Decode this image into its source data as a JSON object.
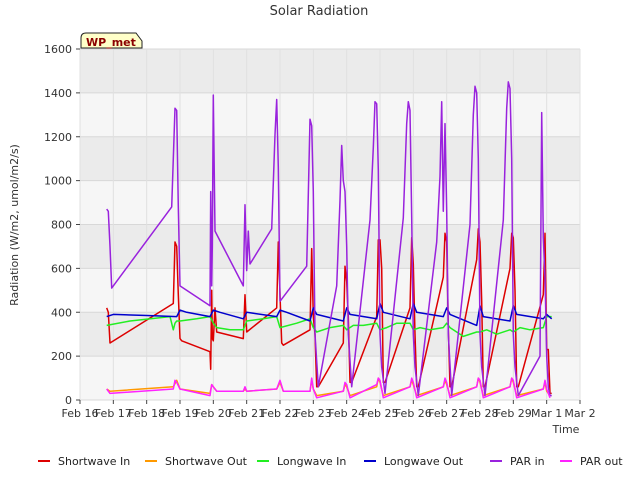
{
  "chart_data": {
    "type": "line",
    "title": "Solar Radiation",
    "xlabel": "Time",
    "ylabel": "Radiation (W/m2, umol/m2/s)",
    "badge": "WP_met",
    "x_range_days": [
      16,
      31
    ],
    "ylim": [
      0,
      1600
    ],
    "yticks": [
      0,
      200,
      400,
      600,
      800,
      1000,
      1200,
      1400,
      1600
    ],
    "xticks": [
      {
        "x": 16,
        "label": "Feb 16"
      },
      {
        "x": 17,
        "label": "Feb 17"
      },
      {
        "x": 18,
        "label": "Feb 18"
      },
      {
        "x": 19,
        "label": "Feb 19"
      },
      {
        "x": 20,
        "label": "Feb 20"
      },
      {
        "x": 21,
        "label": "Feb 21"
      },
      {
        "x": 22,
        "label": "Feb 22"
      },
      {
        "x": 23,
        "label": "Feb 23"
      },
      {
        "x": 24,
        "label": "Feb 24"
      },
      {
        "x": 25,
        "label": "Feb 25"
      },
      {
        "x": 26,
        "label": "Feb 26"
      },
      {
        "x": 27,
        "label": "Feb 27"
      },
      {
        "x": 28,
        "label": "Feb 28"
      },
      {
        "x": 29,
        "label": "Feb 29"
      },
      {
        "x": 30,
        "label": "Mar 1"
      },
      {
        "x": 31,
        "label": "Mar 2"
      }
    ],
    "grid": true,
    "legend_position": "bottom",
    "series": [
      {
        "name": "Shortwave In",
        "color": "#dd0000",
        "x": [
          16.8,
          16.85,
          16.9,
          18.8,
          18.85,
          18.9,
          18.95,
          19.0,
          19.05,
          19.9,
          19.92,
          19.95,
          19.97,
          20.0,
          20.05,
          20.1,
          20.9,
          20.95,
          21.0,
          21.9,
          21.95,
          22.0,
          22.05,
          22.1,
          22.9,
          22.95,
          23.0,
          23.05,
          23.1,
          23.15,
          23.9,
          23.95,
          24.0,
          24.05,
          24.1,
          24.15,
          24.9,
          24.95,
          25.0,
          25.05,
          25.1,
          25.15,
          25.9,
          25.95,
          26.0,
          26.05,
          26.1,
          26.15,
          26.9,
          26.95,
          27.0,
          27.05,
          27.1,
          27.15,
          27.9,
          27.95,
          28.0,
          28.05,
          28.1,
          28.15,
          28.9,
          28.95,
          29.0,
          29.05,
          29.1,
          29.15,
          29.9,
          29.95,
          30.0,
          30.05,
          30.1,
          30.15
        ],
        "y": [
          420,
          400,
          260,
          440,
          720,
          700,
          480,
          280,
          270,
          220,
          140,
          500,
          280,
          270,
          420,
          310,
          280,
          480,
          310,
          420,
          720,
          480,
          260,
          250,
          320,
          690,
          380,
          300,
          60,
          60,
          260,
          610,
          540,
          380,
          80,
          80,
          380,
          730,
          730,
          600,
          80,
          80,
          420,
          740,
          620,
          300,
          60,
          60,
          560,
          760,
          720,
          330,
          60,
          60,
          640,
          780,
          720,
          450,
          60,
          60,
          600,
          760,
          740,
          500,
          60,
          60,
          480,
          760,
          230,
          230,
          30,
          30
        ]
      },
      {
        "name": "Shortwave Out",
        "color": "#ff9900",
        "x": [
          16.8,
          16.9,
          18.8,
          18.9,
          19.0,
          19.9,
          19.95,
          20.0,
          20.05,
          20.1,
          20.9,
          20.95,
          21.0,
          21.9,
          22.0,
          22.1,
          22.9,
          22.95,
          23.0,
          23.1,
          23.9,
          23.95,
          24.0,
          24.1,
          24.9,
          24.95,
          25.0,
          25.1,
          25.9,
          25.95,
          26.0,
          26.1,
          26.9,
          26.95,
          27.0,
          27.1,
          27.9,
          27.95,
          28.0,
          28.1,
          28.9,
          28.95,
          29.0,
          29.1,
          29.9,
          29.95,
          30.0,
          30.1
        ],
        "y": [
          50,
          40,
          60,
          90,
          50,
          30,
          70,
          60,
          50,
          40,
          40,
          50,
          40,
          50,
          80,
          40,
          40,
          90,
          50,
          20,
          40,
          70,
          60,
          20,
          60,
          100,
          80,
          20,
          60,
          90,
          70,
          20,
          60,
          90,
          70,
          20,
          60,
          100,
          80,
          20,
          60,
          100,
          80,
          20,
          50,
          80,
          40,
          20
        ]
      },
      {
        "name": "Longwave In",
        "color": "#22ee22",
        "x": [
          16.8,
          17.5,
          18.7,
          18.8,
          18.85,
          18.9,
          19.0,
          19.5,
          19.9,
          20.0,
          20.1,
          20.5,
          20.9,
          21.0,
          21.5,
          21.9,
          22.0,
          22.5,
          22.9,
          23.0,
          23.1,
          23.5,
          23.9,
          24.0,
          24.2,
          24.5,
          24.9,
          25.0,
          25.2,
          25.5,
          25.9,
          26.0,
          26.2,
          26.5,
          26.9,
          27.0,
          27.1,
          27.5,
          27.9,
          28.0,
          28.2,
          28.5,
          28.9,
          29.0,
          29.2,
          29.5,
          29.9,
          30.0,
          30.15
        ],
        "y": [
          340,
          360,
          380,
          320,
          350,
          360,
          360,
          370,
          380,
          350,
          330,
          320,
          320,
          360,
          370,
          380,
          330,
          350,
          370,
          330,
          310,
          330,
          340,
          320,
          340,
          340,
          350,
          320,
          330,
          350,
          350,
          320,
          330,
          320,
          330,
          350,
          330,
          290,
          310,
          310,
          320,
          300,
          320,
          310,
          330,
          320,
          330,
          380,
          380
        ]
      },
      {
        "name": "Longwave Out",
        "color": "#0000cc",
        "x": [
          16.8,
          17.0,
          18.0,
          18.9,
          19.0,
          19.2,
          19.9,
          20.0,
          20.2,
          20.9,
          21.0,
          21.2,
          21.9,
          22.0,
          22.2,
          22.9,
          23.0,
          23.1,
          23.9,
          24.0,
          24.1,
          24.9,
          25.0,
          25.1,
          25.9,
          26.0,
          26.1,
          26.9,
          27.0,
          27.1,
          27.9,
          28.0,
          28.1,
          28.9,
          29.0,
          29.1,
          29.9,
          30.0,
          30.15
        ],
        "y": [
          380,
          390,
          385,
          380,
          410,
          400,
          380,
          410,
          400,
          370,
          400,
          395,
          380,
          410,
          400,
          360,
          420,
          390,
          360,
          420,
          390,
          370,
          440,
          400,
          370,
          440,
          400,
          380,
          420,
          390,
          340,
          430,
          380,
          360,
          430,
          390,
          370,
          390,
          370
        ]
      },
      {
        "name": "PAR in",
        "color": "#9922dd",
        "x": [
          16.8,
          16.85,
          16.9,
          16.95,
          18.75,
          18.8,
          18.85,
          18.9,
          18.95,
          19.0,
          19.9,
          19.92,
          19.95,
          19.97,
          20.0,
          20.05,
          20.9,
          20.95,
          21.0,
          21.05,
          21.1,
          21.75,
          21.85,
          21.9,
          21.95,
          22.0,
          22.05,
          22.1,
          22.8,
          22.9,
          22.95,
          23.0,
          23.05,
          23.15,
          23.7,
          23.8,
          23.85,
          23.9,
          23.95,
          24.0,
          24.05,
          24.15,
          24.7,
          24.8,
          24.85,
          24.9,
          24.95,
          25.0,
          25.05,
          25.15,
          25.7,
          25.8,
          25.85,
          25.9,
          25.95,
          26.0,
          26.05,
          26.15,
          26.7,
          26.8,
          26.85,
          26.9,
          26.95,
          27.0,
          27.05,
          27.15,
          27.7,
          27.8,
          27.85,
          27.9,
          27.95,
          28.0,
          28.05,
          28.15,
          28.7,
          28.8,
          28.85,
          28.9,
          28.95,
          29.0,
          29.05,
          29.15,
          29.8,
          29.85,
          29.9,
          29.95,
          30.0,
          30.05,
          30.1,
          30.15
        ],
        "y": [
          870,
          860,
          700,
          510,
          880,
          1100,
          1330,
          1320,
          880,
          520,
          430,
          950,
          520,
          700,
          1390,
          770,
          520,
          890,
          590,
          770,
          620,
          780,
          1210,
          1370,
          1060,
          450,
          460,
          470,
          610,
          1280,
          1250,
          950,
          300,
          60,
          520,
          910,
          1160,
          1000,
          950,
          700,
          300,
          60,
          820,
          1150,
          1360,
          1350,
          1050,
          300,
          150,
          30,
          830,
          1260,
          1360,
          1320,
          830,
          300,
          150,
          20,
          720,
          1020,
          1360,
          860,
          1260,
          860,
          300,
          20,
          800,
          1300,
          1430,
          1400,
          1100,
          300,
          150,
          20,
          820,
          1330,
          1450,
          1420,
          1100,
          300,
          150,
          20,
          200,
          1310,
          740,
          560,
          200,
          60,
          20,
          20
        ]
      },
      {
        "name": "PAR out",
        "color": "#ff22ff",
        "x": [
          16.8,
          16.9,
          18.8,
          18.85,
          18.9,
          19.0,
          19.9,
          19.95,
          20.0,
          20.05,
          20.1,
          20.9,
          20.95,
          21.0,
          21.9,
          22.0,
          22.1,
          22.9,
          22.95,
          23.0,
          23.1,
          23.9,
          23.95,
          24.0,
          24.1,
          24.9,
          24.95,
          25.0,
          25.1,
          25.9,
          25.95,
          26.0,
          26.1,
          26.9,
          26.95,
          27.0,
          27.1,
          27.9,
          27.95,
          28.0,
          28.1,
          28.9,
          28.95,
          29.0,
          29.1,
          29.9,
          29.95,
          30.0,
          30.1
        ],
        "y": [
          50,
          30,
          50,
          90,
          80,
          50,
          20,
          70,
          60,
          50,
          40,
          40,
          60,
          40,
          50,
          90,
          40,
          40,
          100,
          50,
          10,
          40,
          80,
          70,
          10,
          70,
          100,
          90,
          10,
          60,
          100,
          80,
          10,
          60,
          100,
          80,
          10,
          60,
          100,
          90,
          10,
          60,
          100,
          90,
          10,
          50,
          90,
          50,
          10
        ]
      }
    ]
  }
}
